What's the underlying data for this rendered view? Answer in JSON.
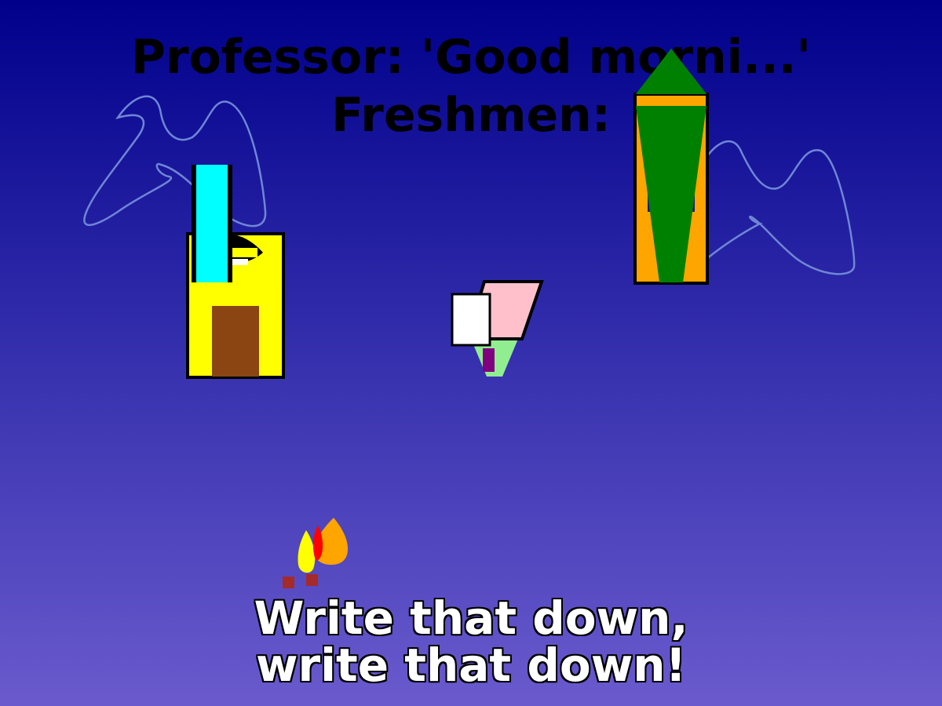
{
  "caption_top": {
    "line1": "Professor: 'Good morni...'",
    "line2": "Freshmen:"
  },
  "caption_bottom": {
    "line1": "Write that down,",
    "line2": "write that down!"
  },
  "colors": {
    "background_top": "#00008b",
    "background_bottom": "#6a5acd",
    "scribble": "#6f86d6",
    "yellow_figure": "#ffff00",
    "cyan_figure": "#00ffff",
    "brown_door": "#8b4513",
    "orange_figure": "#ffa500",
    "green_figure": "#008000",
    "pink_desk": "#ffc0cb",
    "light_green": "#90ee90",
    "purple": "#800080",
    "flame_yellow": "#ffff00",
    "flame_orange": "#ffa500",
    "flame_red": "#ff0000",
    "ember": "#a52a2a"
  },
  "icons": [
    "left-scribble-icon",
    "right-scribble-icon",
    "yellow-block-figure-icon",
    "green-arrow-figure-icon",
    "notepad-desk-icon",
    "flame-icon"
  ]
}
